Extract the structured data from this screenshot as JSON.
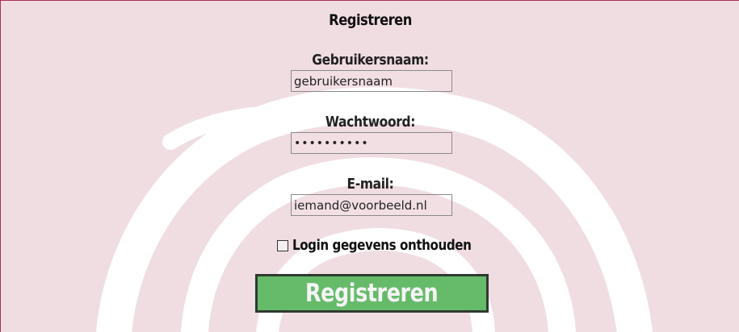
{
  "form": {
    "title": "Registreren",
    "username": {
      "label": "Gebruikersnaam:",
      "value": "gebruikersnaam"
    },
    "password": {
      "label": "Wachtwoord:",
      "value": "••••••••••"
    },
    "email": {
      "label": "E-mail:",
      "value": "iemand@voorbeeld.nl"
    },
    "remember": {
      "label": "Login gegevens onthouden",
      "checked": false
    },
    "submit_label": "Registreren"
  },
  "colors": {
    "background": "#f0dde2",
    "button": "#66bb6a",
    "accent_border": "#a8324f"
  }
}
